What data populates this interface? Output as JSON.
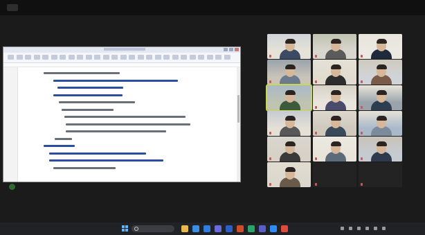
{
  "top_bar": {
    "meeting_title": "",
    "view_label": ""
  },
  "shared_window": {
    "title": "",
    "body_lines": []
  },
  "participants": [
    {
      "name": "",
      "type": "video",
      "muted": true
    },
    {
      "name": "",
      "type": "video",
      "muted": true
    },
    {
      "name": "",
      "type": "video",
      "muted": true
    },
    {
      "name": "",
      "type": "video",
      "muted": true
    },
    {
      "name": "",
      "type": "video",
      "muted": true
    },
    {
      "name": "",
      "type": "video",
      "muted": true
    },
    {
      "name": "",
      "type": "video",
      "muted": false,
      "speaking": true
    },
    {
      "name": "",
      "type": "video",
      "muted": true
    },
    {
      "name": "",
      "type": "video",
      "muted": true
    },
    {
      "name": "",
      "type": "video",
      "muted": true
    },
    {
      "name": "",
      "type": "video",
      "muted": true
    },
    {
      "name": "",
      "type": "video",
      "muted": true
    },
    {
      "name": "",
      "type": "video",
      "muted": true
    },
    {
      "name": "",
      "type": "video",
      "muted": true
    },
    {
      "name": "",
      "type": "video",
      "muted": true
    },
    {
      "name": "",
      "type": "video",
      "muted": true
    },
    {
      "name": "",
      "type": "text",
      "big_label": "",
      "muted": true
    },
    {
      "name": "",
      "type": "text",
      "big_label": "",
      "muted": true
    }
  ],
  "taskbar": {
    "search_placeholder": "",
    "apps": [
      "file-explorer-icon",
      "browser-icon",
      "mail-icon",
      "store-icon",
      "word-icon",
      "powerpoint-icon",
      "chat-icon",
      "teams-icon",
      "zoom-icon",
      "gallery-icon"
    ],
    "clock_time": "",
    "clock_date": ""
  },
  "colors": {
    "speaking_border": "#c9d949",
    "accent": "#2b4f9e"
  }
}
